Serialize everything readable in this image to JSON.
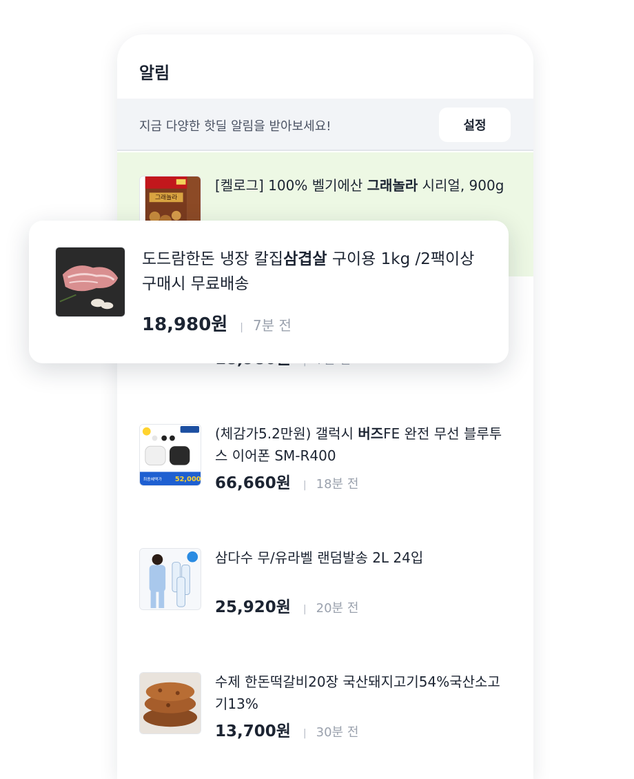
{
  "header": {
    "title": "알림"
  },
  "banner": {
    "text": "지금 다양한 핫딜 알림을 받아보세요!",
    "settings_label": "설정"
  },
  "notifications": [
    {
      "title_pre": "[켈로그] 100% 벨기에산 ",
      "title_bold": "그래놀라",
      "title_post": " 시리얼, 900g",
      "price": "",
      "time": "",
      "thumb_icon": "cereal-box-image",
      "box_text": "그래놀라"
    },
    {
      "title_pre": "",
      "title_bold": "",
      "title_post": "",
      "price": "18,980원",
      "time": "7분 전",
      "thumb_icon": "pork-belly-image"
    },
    {
      "title_pre": "(체감가5.2만원) 갤럭시 ",
      "title_bold": "버즈",
      "title_post": "FE 완전 무선 블루투스 이어폰 SM-R400",
      "price": "66,660원",
      "time": "18분 전",
      "thumb_icon": "earbuds-image",
      "promo_text": "52,000",
      "promo_label": "최종혜택가"
    },
    {
      "title_pre": "삼다수 무/유라벨 랜덤발송 2L 24입",
      "title_bold": "",
      "title_post": "",
      "price": "25,920원",
      "time": "20분 전",
      "thumb_icon": "water-bottles-image"
    },
    {
      "title_pre": "수제 한돈떡갈비20장 국산돼지고기54%국산소고기13%",
      "title_bold": "",
      "title_post": "",
      "price": "13,700원",
      "time": "30분 전",
      "thumb_icon": "tteokgalbi-image"
    }
  ],
  "popup": {
    "title_pre": "도드람한돈 냉장 칼집",
    "title_bold": "삼겹살",
    "title_post": " 구이용 1kg /2팩이상 구매시 무료배송",
    "price": "18,980원",
    "time": "7분 전",
    "thumb_icon": "pork-belly-image"
  },
  "colors": {
    "highlight_bg": "#edf8e4",
    "banner_bg": "#f2f4f7",
    "text": "#1c2432",
    "muted": "#9aa1ad"
  }
}
